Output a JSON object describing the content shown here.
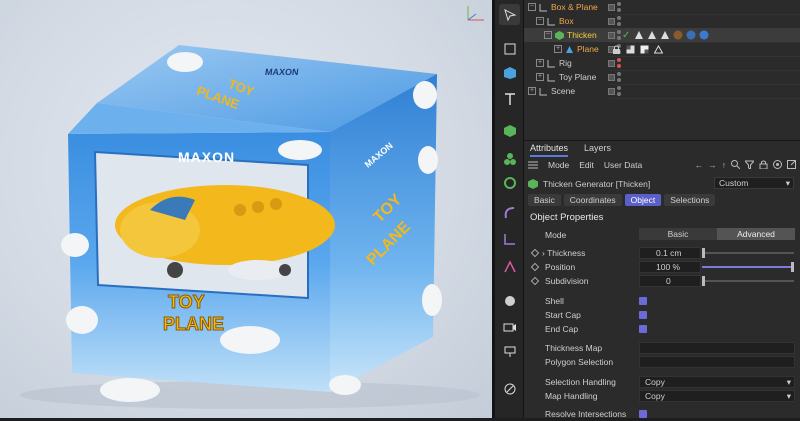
{
  "viewport": {
    "box_brand": "MAXON",
    "box_title_line1": "TOY",
    "box_title_line2": "PLANE"
  },
  "object_manager": {
    "rows": [
      {
        "name": "Box & Plane",
        "indent": 0,
        "color": "orange"
      },
      {
        "name": "Box",
        "indent": 1,
        "color": "orange"
      },
      {
        "name": "Thicken",
        "indent": 2,
        "color": "yellow",
        "selected": true
      },
      {
        "name": "Plane",
        "indent": 3,
        "color": "orange"
      },
      {
        "name": "Rig",
        "indent": 1,
        "color": "normal"
      },
      {
        "name": "Toy Plane",
        "indent": 1,
        "color": "normal"
      },
      {
        "name": "Scene",
        "indent": 0,
        "color": "normal"
      }
    ]
  },
  "attributes": {
    "tabs": [
      "Attributes",
      "Layers"
    ],
    "menu": [
      "Mode",
      "Edit",
      "User Data"
    ],
    "object_title": "Thicken Generator [Thicken]",
    "preset": "Custom",
    "subtabs": [
      "Basic",
      "Coordinates",
      "Object",
      "Selections"
    ],
    "active_subtab": "Object",
    "section": "Object Properties",
    "mode_label": "Mode",
    "mode_options": [
      "Basic",
      "Advanced"
    ],
    "mode_selected": "Advanced",
    "thickness_label": "Thickness",
    "thickness_value": "0.1 cm",
    "position_label": "Position",
    "position_value": "100 %",
    "position_fraction": 1.0,
    "subdivision_label": "Subdivision",
    "subdivision_value": "0",
    "shell_label": "Shell",
    "start_cap_label": "Start Cap",
    "end_cap_label": "End Cap",
    "thickness_map_label": "Thickness Map",
    "polygon_selection_label": "Polygon Selection",
    "selection_handling_label": "Selection Handling",
    "selection_handling_value": "Copy",
    "map_handling_label": "Map Handling",
    "map_handling_value": "Copy",
    "resolve_label": "Resolve Intersections"
  },
  "colors": {
    "accent": "#5b5fc9",
    "box_blue": "#2f86d6",
    "plane_yellow": "#f2b81c"
  }
}
